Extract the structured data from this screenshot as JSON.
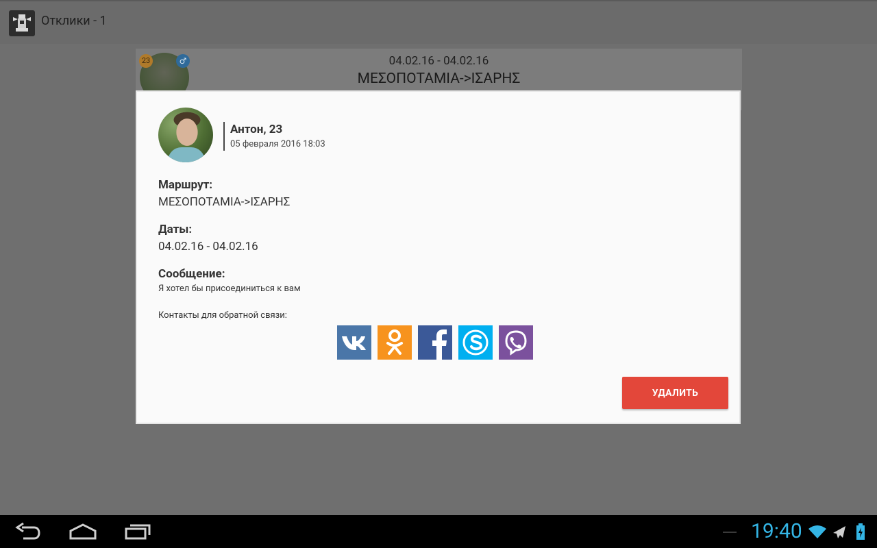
{
  "actionbar": {
    "title": "Отклики - 1"
  },
  "list_item": {
    "age": "23",
    "gender_symbol": "♂",
    "dates": "04.02.16 - 04.02.16",
    "route": "ΜΕΣΟΠΟΤΑΜΙΑ->ΙΣΑΡΗΣ"
  },
  "dialog": {
    "user_name": "Антон, 23",
    "user_date": "05 февраля 2016 18:03",
    "route_label": "Маршрут:",
    "route_value": "ΜΕΣΟΠΟΤΑΜΙΑ->ΙΣΑΡΗΣ",
    "dates_label": "Даты:",
    "dates_value": "04.02.16 - 04.02.16",
    "message_label": "Сообщение:",
    "message_value": "Я хотел бы присоединиться к вам",
    "contacts_label": "Контакты для обратной связи:",
    "socials": [
      {
        "name": "vk",
        "color": "#4a76a8"
      },
      {
        "name": "odnoklassniki",
        "color": "#f7931e"
      },
      {
        "name": "facebook",
        "color": "#3b5998"
      },
      {
        "name": "skype",
        "color": "#00aff0"
      },
      {
        "name": "viber",
        "color": "#7b519d"
      }
    ],
    "delete_label": "УДАЛИТЬ",
    "delete_color": "#e3473a"
  },
  "system_bar": {
    "time": "19:40",
    "accent": "#34b5e5"
  }
}
